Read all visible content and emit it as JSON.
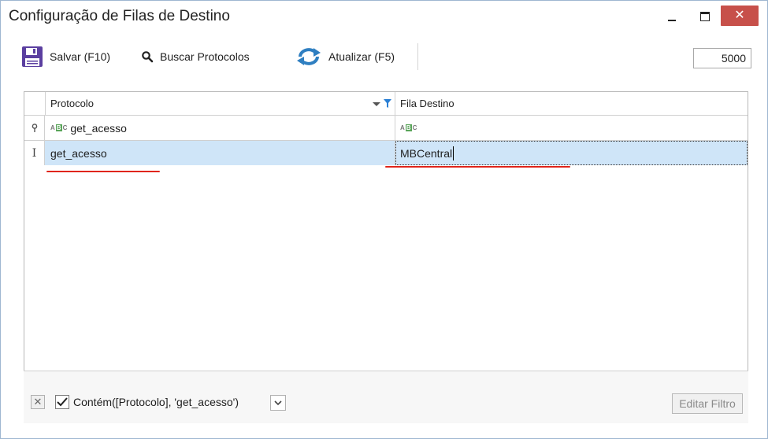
{
  "window": {
    "title": "Configuração de Filas de Destino",
    "controls": {
      "minimize": "minimize",
      "maximize": "maximize",
      "close": "✕"
    }
  },
  "toolbar": {
    "save_label": "Salvar (F10)",
    "search_label": "Buscar Protocolos",
    "refresh_label": "Atualizar (F5)",
    "limit_value": "5000"
  },
  "grid": {
    "columns": [
      {
        "label": "Protocolo"
      },
      {
        "label": "Fila Destino"
      }
    ],
    "filter_row": {
      "protocolo": "get_acesso",
      "fila_destino": ""
    },
    "rows": [
      {
        "protocolo": "get_acesso",
        "fila_destino": "MBCentral"
      }
    ]
  },
  "filter_bar": {
    "expression": "Contém([Protocolo], 'get_acesso')",
    "checked": true,
    "edit_label": "Editar Filtro"
  },
  "colors": {
    "selected_row": "#cfe5f8",
    "annotation_underline": "#e0251b",
    "close_button": "#c7504a",
    "save_icon": "#5b3fa0",
    "refresh_icon": "#2f7fc1"
  }
}
